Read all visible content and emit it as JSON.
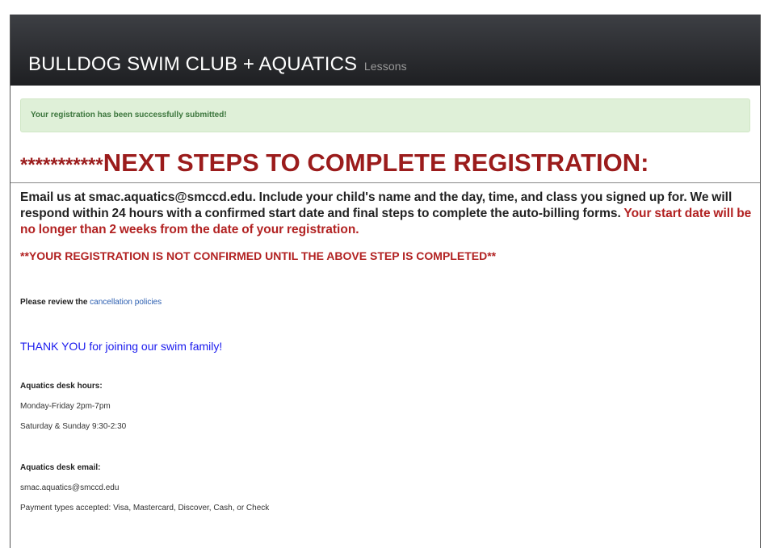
{
  "top_caption": "",
  "header": {
    "brand": "BULLDOG SWIM CLUB + AQUATICS",
    "section": "Lessons"
  },
  "alert": {
    "text": "Your registration has been successfully submitted!"
  },
  "heading": {
    "stars": "***********",
    "text": "NEXT STEPS TO COMPLETE REGISTRATION:"
  },
  "intro": {
    "main": "Email us at smac.aquatics@smccd.edu. Include your child's name and the day, time, and class you signed up for. We will respond within 24 hours with a confirmed start date and final steps to complete the auto-billing forms.",
    "red": "Your start date will be no longer than 2 weeks from the date of your registration."
  },
  "notice": "**YOUR REGISTRATION IS NOT CONFIRMED UNTIL THE ABOVE STEP IS COMPLETED**",
  "review": {
    "prefix": "Please review the ",
    "link": "cancellation policies"
  },
  "thanks": "THANK YOU for joining our swim family!",
  "hours": {
    "title": "Aquatics desk hours:",
    "weekday": "Monday-Friday 2pm-7pm",
    "weekend": "Saturday & Sunday 9:30-2:30"
  },
  "email": {
    "title": "Aquatics desk email:",
    "address": "smac.aquatics@smccd.edu"
  },
  "payment": "Payment types accepted: Visa, Mastercard, Discover, Cash, or Check"
}
